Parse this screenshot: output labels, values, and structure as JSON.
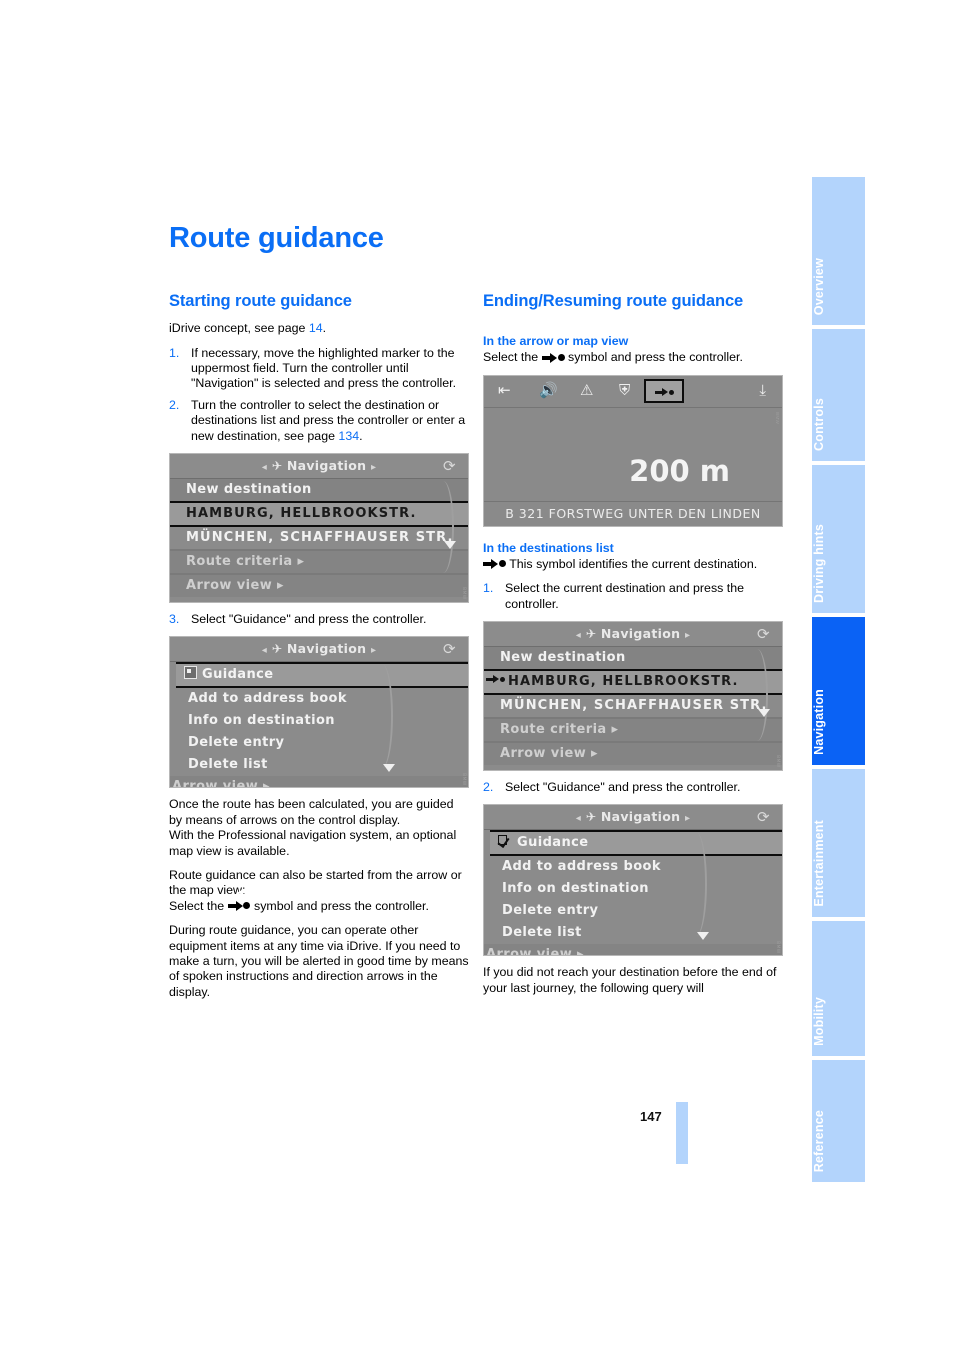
{
  "document": {
    "title": "Route guidance",
    "page_number": "147"
  },
  "left_column": {
    "section_heading": "Starting route guidance",
    "intro": "iDrive concept, see page ",
    "intro_page_ref": "14",
    "intro_end": ".",
    "steps": [
      {
        "num": "1.",
        "text": "If necessary, move the highlighted marker to the uppermost field. Turn the controller until \"Navigation\" is selected and press the controller."
      },
      {
        "num": "2.",
        "text": "Turn the controller to select the destination or destinations list and press the controller or enter a new destination, see page "
      }
    ],
    "step2_page_ref": "134",
    "step2_end": ".",
    "step3": {
      "num": "3.",
      "text": "Select \"Guidance\" and press the controller."
    },
    "para1": "Once the route has been calculated, you are guided by means of arrows on the control display.",
    "para2": "With the Professional navigation system, an optional map view is available.",
    "para3": "Route guidance can also be started from the arrow or the map view:",
    "para4_before": "Select the ",
    "para4_after": " symbol and press the controller.",
    "para5": "During route guidance, you can operate other equipment items at any time via iDrive. If you need to make a turn, you will be alerted in good time by means of spoken instructions and direction arrows in the display."
  },
  "right_column": {
    "section_heading": "Ending/Resuming route guidance",
    "sub1": "In the arrow or map view",
    "sub1_before": "Select the ",
    "sub1_after": " symbol and press the controller.",
    "sub2": "In the destinations list",
    "sub2_text": " This symbol identifies the current destination.",
    "step1": {
      "num": "1.",
      "text": "Select the current destination and press the controller."
    },
    "step2": {
      "num": "2.",
      "text": "Select \"Guidance\" and press the controller."
    },
    "closing": "If you did not reach your destination before the end of your last journey, the following query will"
  },
  "screenshots": {
    "nav_menu_1": {
      "titlebar": "Navigation",
      "rows": [
        {
          "label": "New destination",
          "state": "normal"
        },
        {
          "label": "HAMBURG, HELLBROOKSTR.",
          "state": "selected"
        },
        {
          "label": "MÜNCHEN, SCHAFFHAUSER STR.",
          "state": "normal"
        }
      ],
      "footer_rows": [
        "Route criteria",
        "Arrow view"
      ]
    },
    "guidance_menu_1": {
      "titlebar": "Navigation",
      "rows": [
        {
          "label": "Guidance",
          "state": "selected",
          "checkbox": "empty"
        },
        {
          "label": "Add to address book",
          "state": "normal"
        },
        {
          "label": "Info on destination",
          "state": "normal"
        },
        {
          "label": "Delete entry",
          "state": "normal"
        },
        {
          "label": "Delete list",
          "state": "normal"
        }
      ],
      "footer_rows": [
        "Arrow view"
      ]
    },
    "arrow_view": {
      "distance": "200 m",
      "street": "B 321 FORSTWEG UNTER DEN LINDEN",
      "icons": [
        "back-icon",
        "volume-icon",
        "warning-icon",
        "highway-icon",
        "destination-icon",
        "download-icon"
      ]
    },
    "nav_menu_2": {
      "titlebar": "Navigation",
      "rows": [
        {
          "label": "New destination",
          "state": "normal"
        },
        {
          "label": "HAMBURG, HELLBROOKSTR.",
          "state": "selected",
          "glyph": "destination-arrow"
        },
        {
          "label": "MÜNCHEN, SCHAFFHAUSER STR.",
          "state": "normal"
        }
      ],
      "footer_rows": [
        "Route criteria",
        "Arrow view"
      ]
    },
    "guidance_menu_2": {
      "titlebar": "Navigation",
      "rows": [
        {
          "label": "Guidance",
          "state": "selected",
          "checkbox": "checked"
        },
        {
          "label": "Add to address book",
          "state": "normal"
        },
        {
          "label": "Info on destination",
          "state": "normal"
        },
        {
          "label": "Delete entry",
          "state": "normal"
        },
        {
          "label": "Delete list",
          "state": "normal"
        }
      ],
      "footer_rows": [
        "Arrow view"
      ]
    }
  },
  "sidebar": {
    "tabs": [
      {
        "label": "Overview",
        "active": false
      },
      {
        "label": "Controls",
        "active": false
      },
      {
        "label": "Driving hints",
        "active": false
      },
      {
        "label": "Navigation",
        "active": true
      },
      {
        "label": "Entertainment",
        "active": false
      },
      {
        "label": "Mobility",
        "active": false
      },
      {
        "label": "Reference",
        "active": false
      }
    ],
    "active_color": "#0a62f5",
    "inactive_color": "#b3d4fc"
  }
}
